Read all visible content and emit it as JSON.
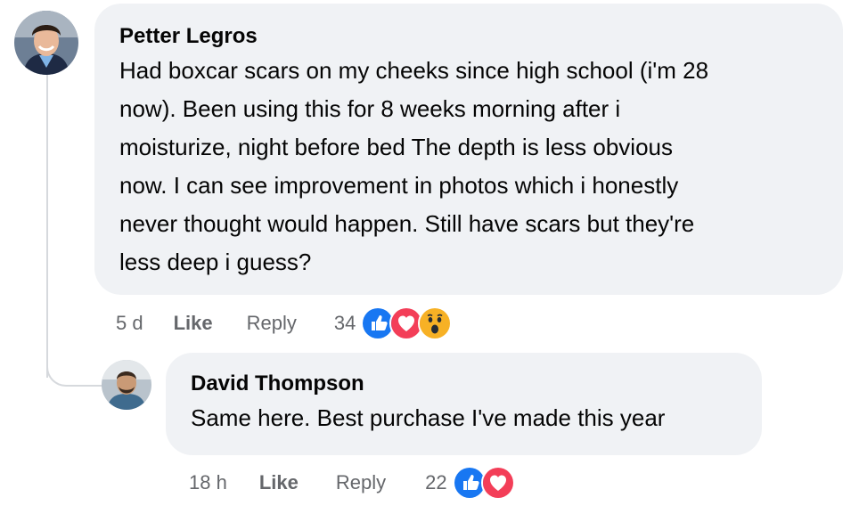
{
  "comment": {
    "author": "Petter Legros",
    "text_lines": [
      "Had boxcar scars on my cheeks since high school (i'm 28",
      "now). Been using this for 8 weeks morning after i",
      "moisturize, night before bed The depth is less obvious",
      "now. I can see improvement in photos which i honestly",
      "never thought would happen. Still have scars but they're",
      "less deep i guess?"
    ],
    "time": "5 d",
    "like_label": "Like",
    "reply_label": "Reply",
    "reaction_count": "34",
    "reactions": [
      "like-icon",
      "love-icon",
      "wow-icon"
    ]
  },
  "reply": {
    "author": "David Thompson",
    "text": "Same here. Best purchase I've made this year",
    "time": "18 h",
    "like_label": "Like",
    "reply_label": "Reply",
    "reaction_count": "22",
    "reactions": [
      "like-icon",
      "love-icon"
    ]
  },
  "colors": {
    "bubble": "#f0f2f5",
    "like_blue": "#1877f2",
    "love_red": "#f33e58",
    "wow_yellow": "#f7b125",
    "meta_gray": "#65676b"
  }
}
